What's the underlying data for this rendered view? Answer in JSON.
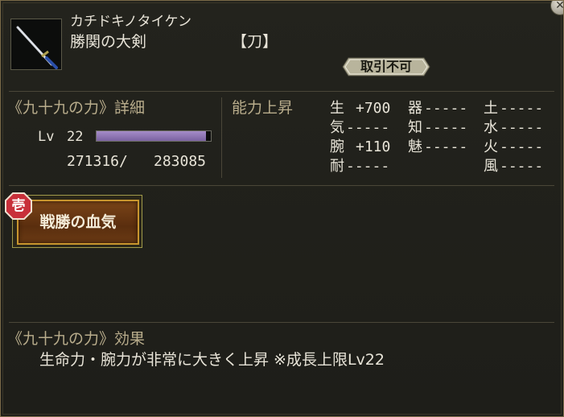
{
  "window": {
    "close_icon": "close-icon"
  },
  "item": {
    "icon": "katana-icon",
    "reading": "カチドキノタイケン",
    "name": "勝関の大剣",
    "type": "【刀】",
    "trade_status": "取引不可"
  },
  "detail": {
    "title": "《九十九の力》詳細",
    "level_label": "Lv",
    "level": "22",
    "xp_current": "271316/",
    "xp_max": "283085",
    "xp_fraction": 0.958
  },
  "ability": {
    "title": "能力上昇",
    "stats": [
      {
        "label": "生",
        "value": "+700"
      },
      {
        "label": "気",
        "value": "-----"
      },
      {
        "label": "腕",
        "value": "+110"
      },
      {
        "label": "耐",
        "value": "-----"
      },
      {
        "label": "器",
        "value": "-----"
      },
      {
        "label": "知",
        "value": "-----"
      },
      {
        "label": "魅",
        "value": "-----"
      },
      {
        "label": "土",
        "value": "-----"
      },
      {
        "label": "水",
        "value": "-----"
      },
      {
        "label": "火",
        "value": "-----"
      },
      {
        "label": "風",
        "value": "-----"
      }
    ]
  },
  "skill": {
    "badge": "壱",
    "name": "戦勝の血気"
  },
  "effect": {
    "title": "《九十九の力》効果",
    "description": "生命力・腕力が非常に大きく上昇 ※成長上限Lv22"
  },
  "colors": {
    "background": "#1e1e19",
    "text": "#e8e4d8",
    "heading": "#b9ad8c",
    "xp_bar": "#8a72b0",
    "skill_frame": "#c8952e",
    "badge_red": "#c8303a"
  }
}
